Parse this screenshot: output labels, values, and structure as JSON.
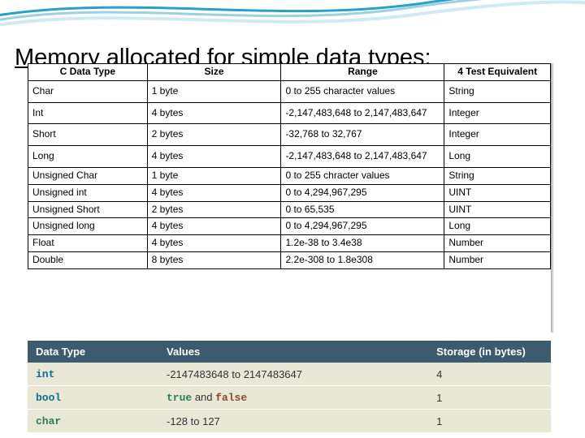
{
  "title": "Memory allocated for simple data types:",
  "table1": {
    "headers": [
      "C Data Type",
      "Size",
      "Range",
      "4 Test Equivalent"
    ],
    "rows": [
      {
        "type": "Char",
        "size": "1 byte",
        "range": "0 to 255 character values",
        "eq": "String",
        "tall": true
      },
      {
        "type": "Int",
        "size": "4 bytes",
        "range": "-2,147,483,648 to 2,147,483,647",
        "eq": "Integer",
        "tall": true
      },
      {
        "type": "Short",
        "size": "2 bytes",
        "range": "-32,768 to 32,767",
        "eq": "Integer",
        "tall": true
      },
      {
        "type": "Long",
        "size": "4 bytes",
        "range": "-2,147,483,648 to 2,147,483,647",
        "eq": "Long",
        "tall": true
      },
      {
        "type": "Unsigned Char",
        "size": "1 byte",
        "range": "0 to 255 chracter values",
        "eq": "String"
      },
      {
        "type": "Unsigned int",
        "size": "4 bytes",
        "range": "0 to 4,294,967,295",
        "eq": "UINT"
      },
      {
        "type": "Unsigned Short",
        "size": "2 bytes",
        "range": "0 to 65,535",
        "eq": "UINT"
      },
      {
        "type": "Unsigned long",
        "size": "4 bytes",
        "range": "0 to 4,294,967,295",
        "eq": "Long"
      },
      {
        "type": "Float",
        "size": "4 bytes",
        "range": "1.2e-38 to 3.4e38",
        "eq": "Number"
      },
      {
        "type": "Double",
        "size": "8 bytes",
        "range": "2.2e-308 to 1.8e308",
        "eq": "Number"
      }
    ]
  },
  "table2": {
    "headers": [
      "Data Type",
      "Values",
      "Storage (in bytes)"
    ],
    "rows": [
      {
        "key": "int",
        "css": "c-int",
        "valPlain": "-2147483648 to 2147483647",
        "storage": "4"
      },
      {
        "key": "bool",
        "css": "c-bool",
        "valBool": true,
        "true": "true",
        "and": " and ",
        "false": "false",
        "storage": "1"
      },
      {
        "key": "char",
        "css": "c-char",
        "valPlain": "-128 to 127",
        "storage": "1"
      }
    ]
  }
}
